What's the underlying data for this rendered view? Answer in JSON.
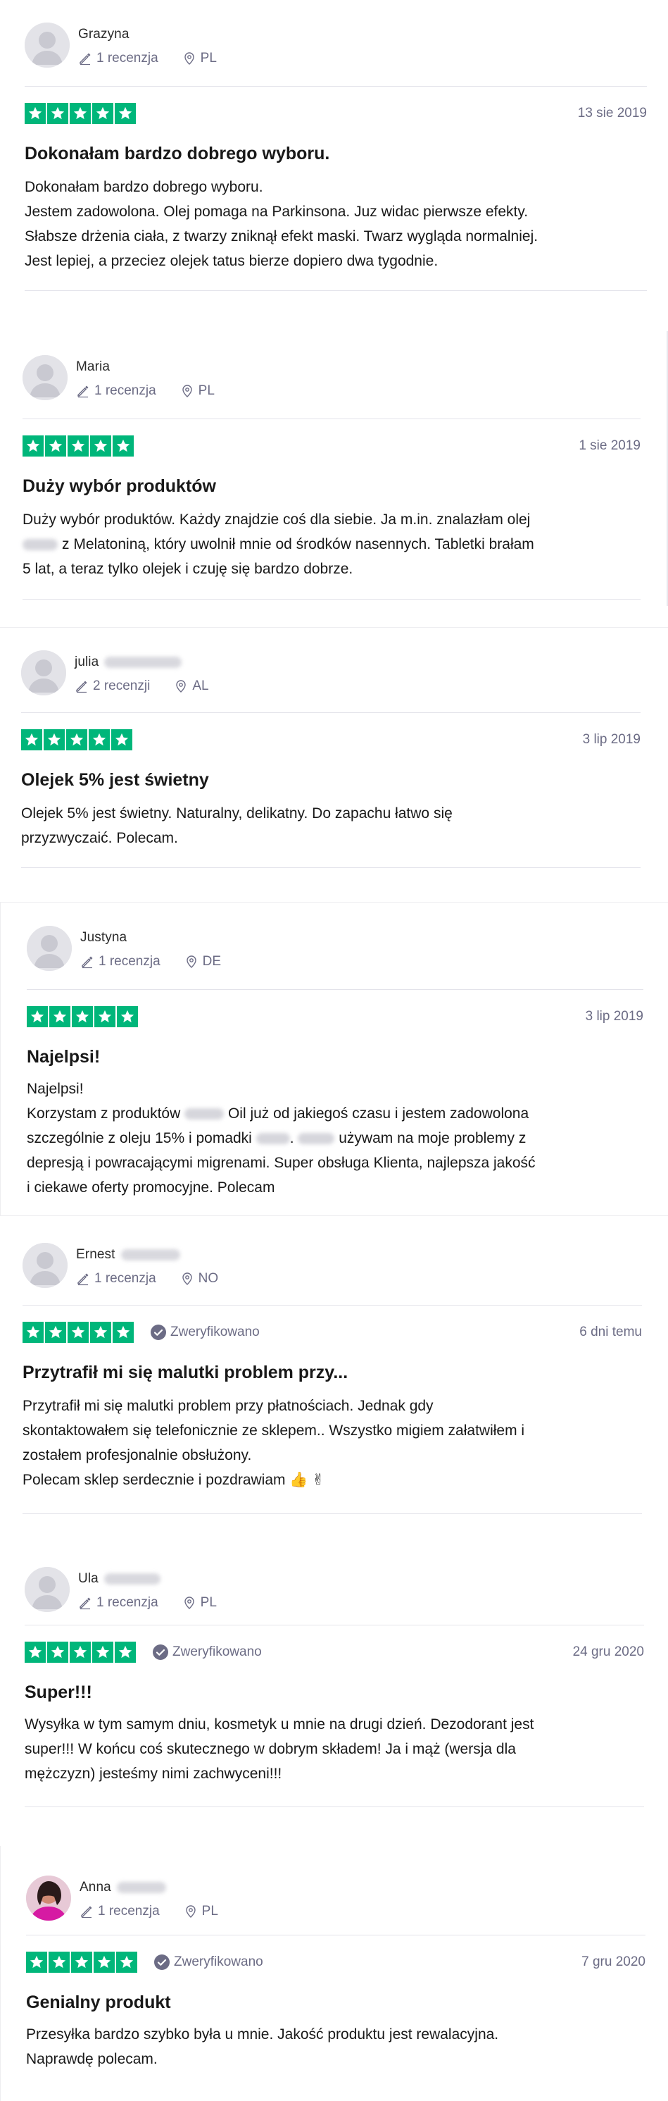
{
  "reviews": [
    {
      "name": "Grazyna",
      "name_suffix_hidden": false,
      "count": "1 recenzja",
      "country": "PL",
      "verified": false,
      "date": "13 sie 2019",
      "title": "Dokonałam bardzo dobrego wyboru.",
      "body": [
        "Dokonałam bardzo dobrego wyboru.",
        "Jestem zadowolona. Olej pomaga na Parkinsona. Juz widac pierwsze efekty.",
        "Słabsze drżenia ciała, z twarzy zniknął efekt maski. Twarz wygląda normalniej.",
        "Jest lepiej, a przeciez olejek tatus bierze dopiero dwa tygodnie."
      ]
    },
    {
      "name": "Maria",
      "count": "1 recenzja",
      "country": "PL",
      "verified": false,
      "date": "1 sie 2019",
      "title": "Duży wybór produktów",
      "body_1": "Duży wybór produktów. Każdy znajdzie coś dla siebie. Ja m.in. znalazłam olej",
      "body_2": "z Melatoniną, który uwolnił mnie od środków nasennych. Tabletki brałam",
      "body_3": "5 lat, a teraz tylko olejek i czuję się bardzo dobrze."
    },
    {
      "name": "julia",
      "count": "2 recenzji",
      "country": "AL",
      "verified": false,
      "date": "3 lip 2019",
      "title": "Olejek 5% jest świetny",
      "body": [
        "Olejek 5% jest świetny. Naturalny, delikatny. Do zapachu łatwo się",
        "przyzwyczaić. Polecam."
      ]
    },
    {
      "name": "Justyna",
      "count": "1 recenzja",
      "country": "DE",
      "verified": false,
      "date": "3 lip 2019",
      "title": "Najelpsi!",
      "body_1": "Najelpsi!",
      "body_2a": "Korzystam z produktów",
      "body_2b": "Oil już od jakiegoś czasu i jestem zadowolona",
      "body_3a": "szczególnie z oleju 15% i pomadki",
      "body_3b": ".",
      "body_3c": "używam na moje problemy z",
      "body_4": "depresją i powracającymi migrenami. Super obsługa Klienta, najlepsza jakość",
      "body_5": "i ciekawe oferty promocyjne. Polecam"
    },
    {
      "name": "Ernest",
      "count": "1 recenzja",
      "country": "NO",
      "verified": true,
      "verified_label": "Zweryfikowano",
      "date": "6 dni temu",
      "title": "Przytrafił mi się malutki problem przy...",
      "body": [
        "Przytrafił mi się malutki problem przy płatnościach. Jednak gdy",
        "skontaktowałem się telefonicznie ze sklepem.. Wszystko migiem załatwiłem i",
        "zostałem profesjonalnie obsłużony.",
        "Polecam sklep serdecznie i pozdrawiam 👍 ✌"
      ]
    },
    {
      "name": "Ula",
      "count": "1 recenzja",
      "country": "PL",
      "verified": true,
      "verified_label": "Zweryfikowano",
      "date": "24 gru 2020",
      "title": "Super!!!",
      "body": [
        "Wysyłka w tym samym dniu, kosmetyk u mnie na drugi dzień. Dezodorant jest",
        "super!!! W końcu coś skutecznego w dobrym składem! Ja i mąż (wersja dla",
        "mężczyzn) jesteśmy nimi zachwyceni!!!"
      ]
    },
    {
      "name": "Anna",
      "count": "1 recenzja",
      "country": "PL",
      "verified": true,
      "verified_label": "Zweryfikowano",
      "date": "7 gru 2020",
      "title": "Genialny produkt",
      "body": [
        "Przesyłka bardzo szybko była u mnie. Jakość produktu jest rewalacyjna.",
        "Naprawdę polecam."
      ]
    }
  ],
  "colors": {
    "star_green": "#00b67a",
    "meta_gray": "#6c6c85",
    "divider": "#e3e3ea"
  },
  "icons": [
    "avatar-placeholder-icon",
    "pencil-icon",
    "location-pin-icon",
    "star-icon",
    "verified-check-icon"
  ]
}
